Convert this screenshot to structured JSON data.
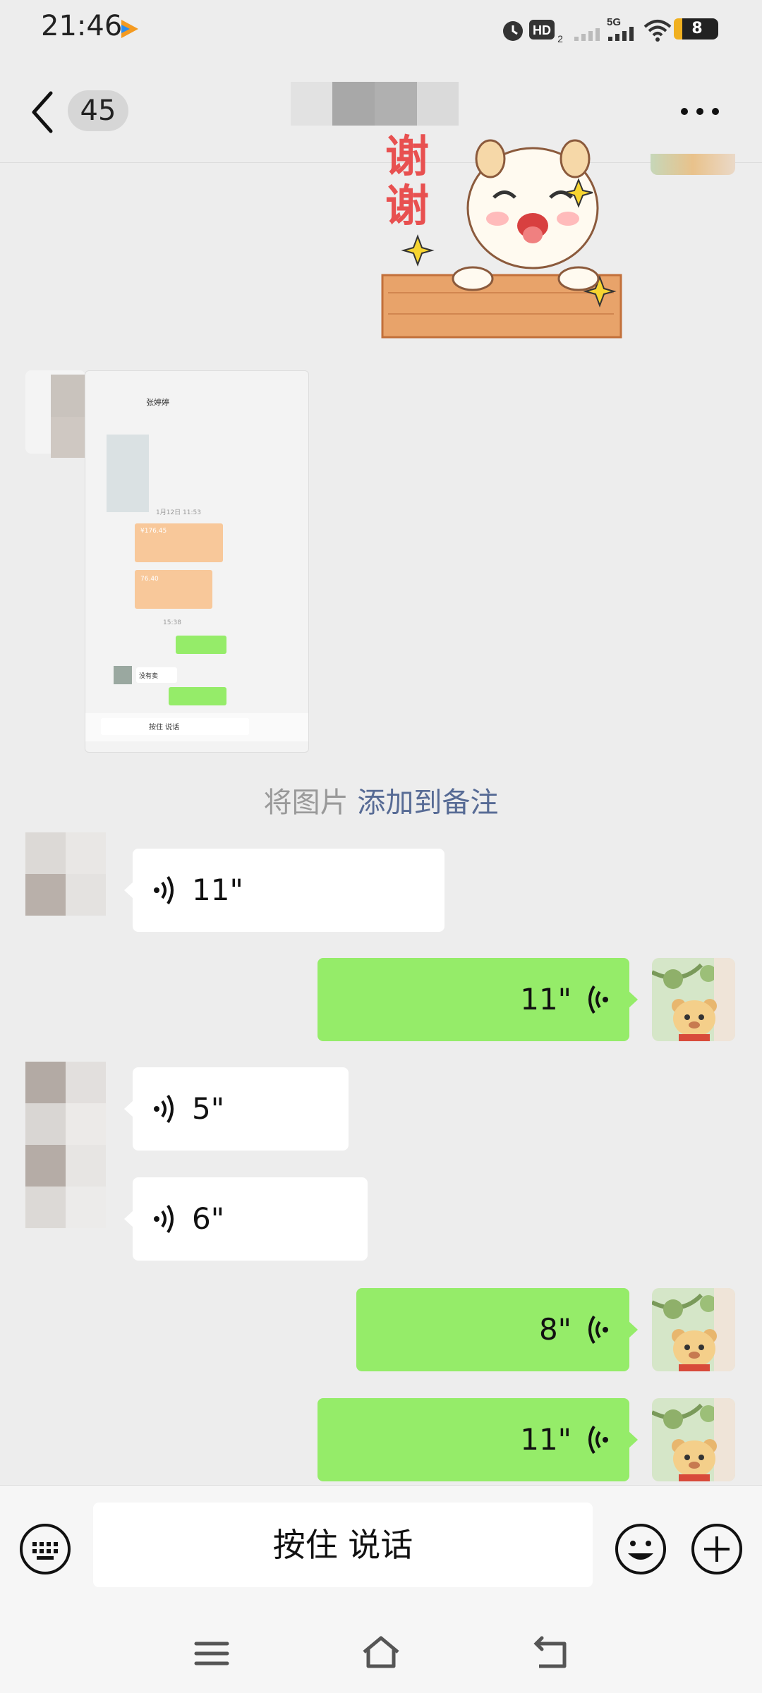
{
  "status_bar": {
    "time": "21:46",
    "battery_level": "8",
    "network_label": "5G",
    "hd_label": "HD2"
  },
  "header": {
    "unread_count": "45"
  },
  "messages": {
    "hint_prefix": "将图片",
    "hint_link": "添加到备注",
    "sticker_text": "谢谢",
    "screenshot": {
      "title": "张婷婷",
      "date": "1月12日 11:53",
      "time2": "15:38",
      "text1": "没有卖",
      "amount1": "¥176.45",
      "amount2": "76.40",
      "btn": "按住 说话"
    },
    "voice": [
      {
        "dir": "in",
        "duration": "11\""
      },
      {
        "dir": "out",
        "duration": "11\""
      },
      {
        "dir": "in",
        "duration": "5\""
      },
      {
        "dir": "in",
        "duration": "6\""
      },
      {
        "dir": "out",
        "duration": "8\""
      },
      {
        "dir": "out",
        "duration": "11\""
      }
    ]
  },
  "input_bar": {
    "hold_to_talk": "按住 说话"
  },
  "colors": {
    "background": "#ededed",
    "outgoing_bubble": "#95ec69",
    "incoming_bubble": "#ffffff",
    "link": "#576b95"
  }
}
